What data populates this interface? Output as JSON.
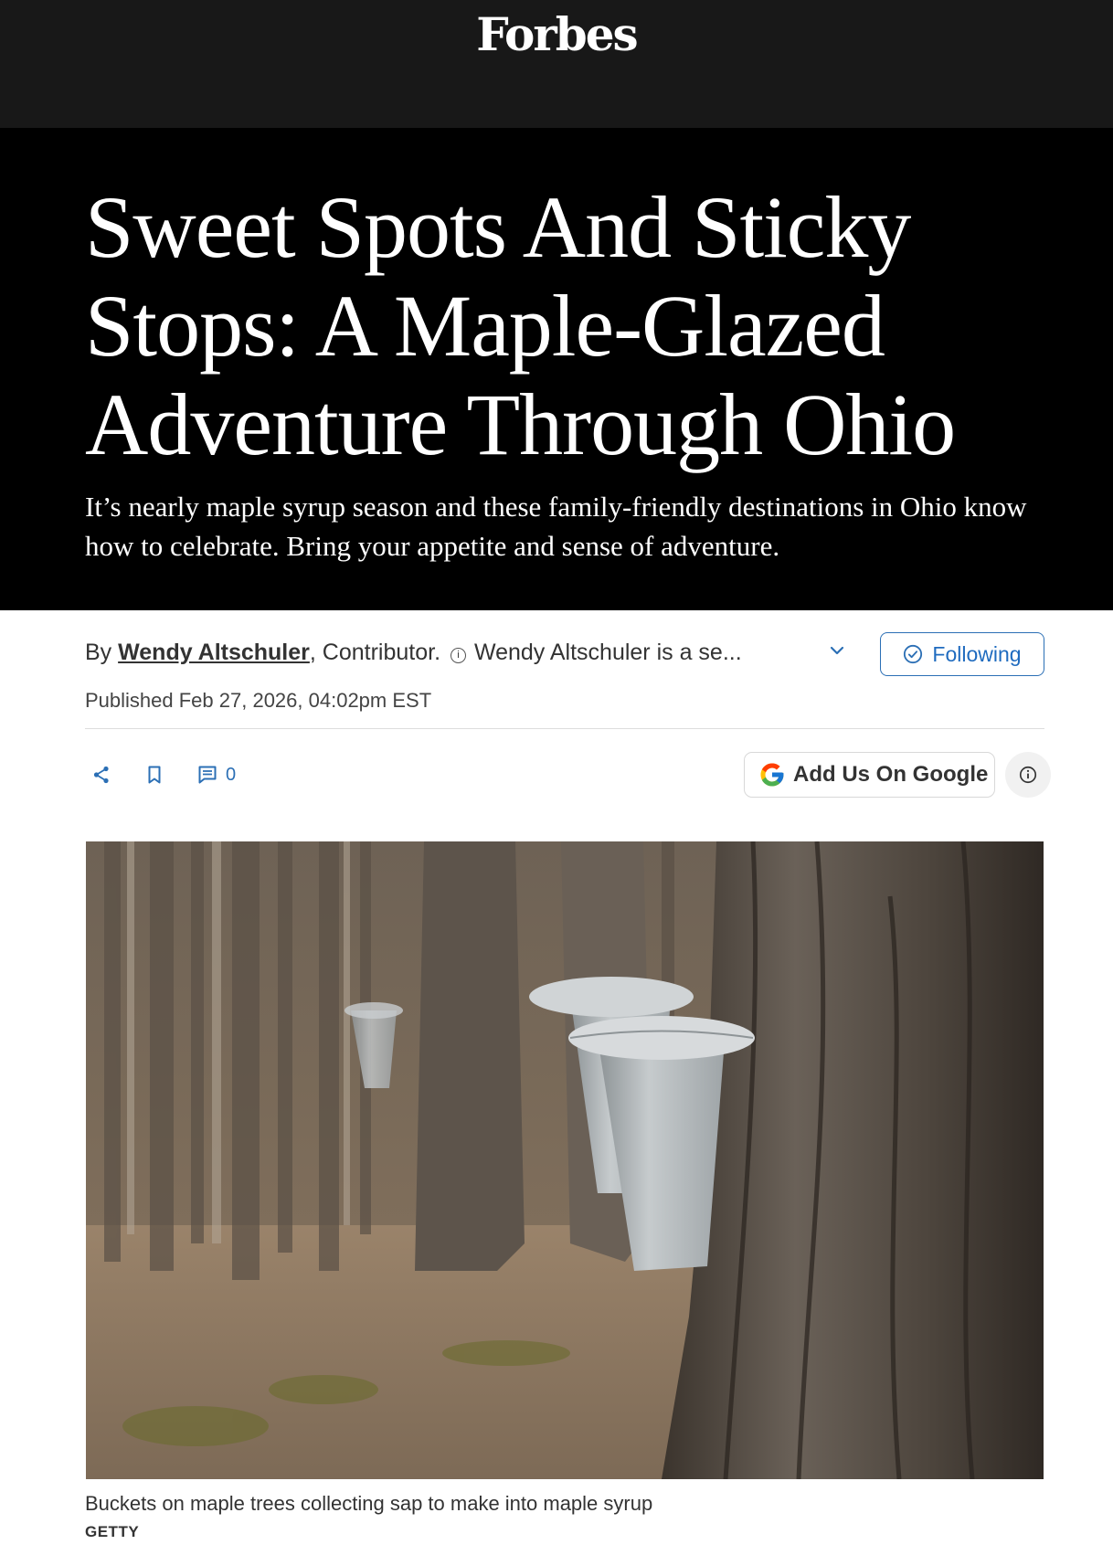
{
  "site": {
    "logo": "Forbes"
  },
  "article": {
    "title": "Sweet Spots And Sticky Stops: A Maple-Glazed Adventure Through Ohio",
    "dek": "It’s nearly maple syrup season and these family-friendly destinations in Ohio know how to celebrate. Bring your appetite and sense of adventure.",
    "byline_prefix": "By ",
    "author": "Wendy Altschuler",
    "role": ", Contributor.",
    "bio_snippet": "Wendy Altschuler is a se...",
    "follow_label": "Following",
    "published": "Published Feb 27, 2026, 04:02pm EST",
    "comment_count": "0"
  },
  "google_button": {
    "label": "Add Us On Google"
  },
  "image": {
    "alt": "Buckets on maple trees collecting sap to make into maple syrup",
    "caption": "Buckets on maple trees collecting sap to make into maple syrup",
    "credit": "GETTY"
  },
  "icons": [
    "share-icon",
    "bookmark-icon",
    "comment-icon",
    "chevron-down-icon",
    "check-circle-icon",
    "google-g-icon",
    "info-icon"
  ],
  "colors": {
    "topbar": "#181818",
    "hero": "#000000",
    "accent": "#2b6fb5"
  }
}
